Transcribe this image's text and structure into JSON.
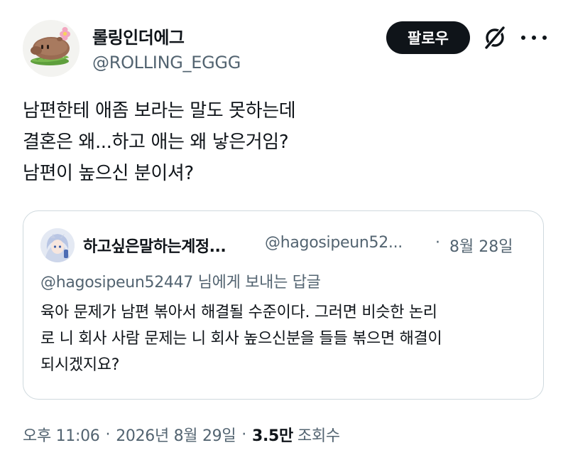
{
  "author": {
    "display_name": "롤링인더에그",
    "handle": "@ROLLING_EGGG"
  },
  "header": {
    "follow_label": "팔로우",
    "grok_icon": "grok-slash-icon",
    "more_icon": "more-dots-icon"
  },
  "tweet": {
    "lines": [
      "남편한테 애좀 보라는 말도 못하는데",
      "결혼은 왜...하고 애는 왜 낳은거임?",
      "남편이 높으신 분이셔?"
    ]
  },
  "quote": {
    "display_name": "하고싶은말하는계정...",
    "handle": "@hagosipeun52...",
    "separator": "·",
    "date": "8월 28일",
    "reply_to": "@hagosipeun52447 님에게 보내는 답글",
    "lines": [
      "육아 문제가 남편 볶아서 해결될 수준이다. 그러면 비슷한 논리",
      "로 니 회사 사람 문제는 니 회사 높으신분을 들들 볶으면 해결이",
      "되시겠지요?"
    ]
  },
  "meta": {
    "time": "오후 11:06",
    "separator": "·",
    "date": "2026년 8월 29일",
    "views_count": "3.5만",
    "views_label": "조회수"
  },
  "colors": {
    "text_primary": "#0f1419",
    "text_secondary": "#536471",
    "border": "#cfd9de",
    "button_bg": "#0f1419",
    "button_text": "#ffffff"
  }
}
